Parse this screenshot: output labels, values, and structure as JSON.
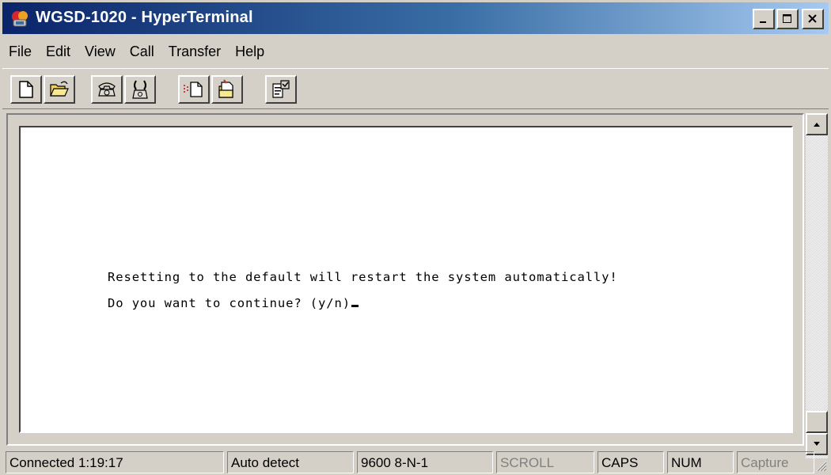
{
  "window": {
    "title": "WGSD-1020 - HyperTerminal",
    "app_icon": "hyperterminal-icon",
    "title_gradient": [
      "#0a246a",
      "#a6caf0"
    ]
  },
  "caption_buttons": [
    "minimize-icon",
    "maximize-icon",
    "close-icon"
  ],
  "menu": {
    "items": [
      "File",
      "Edit",
      "View",
      "Call",
      "Transfer",
      "Help"
    ]
  },
  "toolbar": {
    "buttons": [
      {
        "name": "new-connection",
        "icon": "new-document-icon"
      },
      {
        "name": "open",
        "icon": "open-folder-icon"
      },
      {
        "name": "call",
        "icon": "phone-icon"
      },
      {
        "name": "disconnect",
        "icon": "disconnect-phone-icon"
      },
      {
        "name": "send",
        "icon": "send-file-icon"
      },
      {
        "name": "receive",
        "icon": "receive-file-icon"
      },
      {
        "name": "properties",
        "icon": "properties-icon"
      }
    ]
  },
  "terminal": {
    "background": "#ffffff",
    "lines": [
      "Resetting to the default will restart the system automatically!",
      "Do you want to continue? (y/n)"
    ]
  },
  "status": {
    "connected": "Connected 1:19:17",
    "detect": "Auto detect",
    "port": "9600 8-N-1",
    "scroll": "SCROLL",
    "caps": "CAPS",
    "num": "NUM",
    "capture": "Capture"
  }
}
